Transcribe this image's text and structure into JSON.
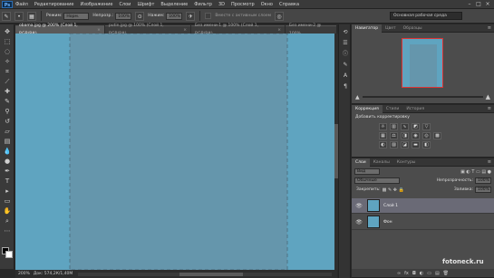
{
  "app": {
    "logo": "Ps"
  },
  "menu": [
    "Файл",
    "Редактирование",
    "Изображение",
    "Слои",
    "Шрифт",
    "Выделение",
    "Фильтр",
    "3D",
    "Просмотр",
    "Окно",
    "Справка"
  ],
  "window_controls": [
    "–",
    "□",
    "×"
  ],
  "options_bar": {
    "mode_label": "Режим:",
    "mode_value": "Норм.",
    "opacity_label": "Непрозр.:",
    "opacity_value": "100%",
    "flow_label": "Нажим:",
    "flow_value": "100%",
    "checkbox_label": "Вместе с активным слоем"
  },
  "workspace": {
    "value": "Основная рабочая среда"
  },
  "tabs": [
    {
      "label": "obama.jpg @ 200% (Слой 1, RGB/8#)",
      "active": true
    },
    {
      "label": "putin.jpg @ 100% (Слой 1, RGB/8#)",
      "active": false
    },
    {
      "label": "Без имени-1 @ 100% (Слой 1, RGB/8#)",
      "active": false
    },
    {
      "label": "Без имени-2 @ 100%",
      "active": false
    }
  ],
  "status": {
    "zoom": "200%",
    "doc": "Док: 574,2К/1,40М"
  },
  "navigator": {
    "tabs": [
      "Навигатор",
      "Цвет",
      "Образцы"
    ]
  },
  "adjustments": {
    "tabs": [
      "Коррекция",
      "Стили",
      "История"
    ],
    "title": "Добавить корректировку"
  },
  "layers": {
    "tabs": [
      "Слои",
      "Каналы",
      "Контуры"
    ],
    "filter": "Вид",
    "blend": "Обычные",
    "opacity_label": "Непрозрачность:",
    "opacity_value": "100%",
    "lock_label": "Закрепить:",
    "fill_label": "Заливка:",
    "fill_value": "100%",
    "items": [
      {
        "name": "Слой 1",
        "selected": true
      },
      {
        "name": "Фон",
        "selected": false
      }
    ]
  },
  "watermark": "fotoneck.ru"
}
